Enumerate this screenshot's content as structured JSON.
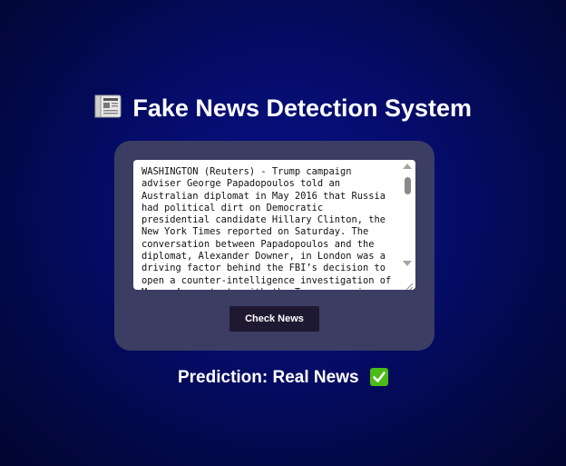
{
  "header": {
    "title": "Fake News Detection System",
    "icon": "newspaper-icon"
  },
  "form": {
    "news_text": "WASHINGTON (Reuters) - Trump campaign adviser George Papadopoulos told an Australian diplomat in May 2016 that Russia had political dirt on Democratic presidential candidate Hillary Clinton, the New York Times reported on Saturday. The conversation between Papadopoulos and the diplomat, Alexander Downer, in London was a driving factor behind the FBI’s decision to open a counter-intelligence investigation of Moscow’s contacts with the Trump campaign",
    "submit_label": "Check News"
  },
  "result": {
    "prediction": "Prediction: Real News",
    "status_icon": "check-mark-icon",
    "status_color": "#4cbb17"
  },
  "colors": {
    "background": "#050c6a",
    "card": "#3b3d63",
    "button": "#1e1931"
  }
}
